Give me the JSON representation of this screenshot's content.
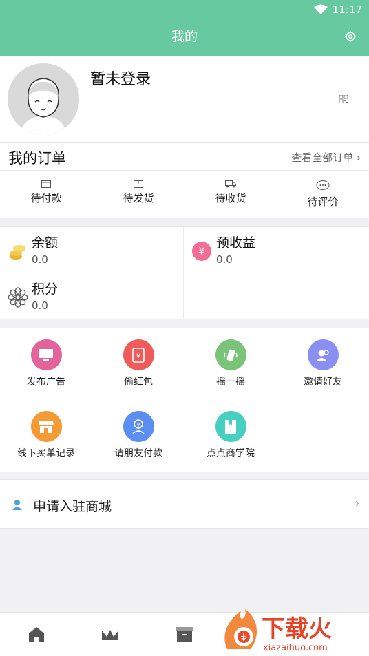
{
  "status": {
    "time": "11:17"
  },
  "header": {
    "title": "我的"
  },
  "profile": {
    "name": "暂未登录"
  },
  "orders": {
    "title": "我的订单",
    "view_all": "查看全部订单 ›",
    "items": [
      {
        "label": "待付款",
        "icon": "wallet-icon"
      },
      {
        "label": "待发货",
        "icon": "package-icon"
      },
      {
        "label": "待收货",
        "icon": "truck-icon"
      },
      {
        "label": "待评价",
        "icon": "comment-icon"
      }
    ]
  },
  "wallet": {
    "balance": {
      "label": "余额",
      "value": "0.0"
    },
    "expected": {
      "label": "预收益",
      "value": "0.0"
    },
    "points": {
      "label": "积分",
      "value": "0.0"
    }
  },
  "features": [
    {
      "label": "发布广告",
      "color": "#e2649b",
      "icon": "monitor-icon"
    },
    {
      "label": "偷红包",
      "color": "#ef5b5b",
      "icon": "red-envelope-icon"
    },
    {
      "label": "摇一摇",
      "color": "#79c479",
      "icon": "shake-icon"
    },
    {
      "label": "邀请好友",
      "color": "#8a8ff3",
      "icon": "invite-friends-icon"
    },
    {
      "label": "线下买单记录",
      "color": "#f59a34",
      "icon": "shop-icon"
    },
    {
      "label": "请朋友付款",
      "color": "#5a8ef0",
      "icon": "pay-friend-icon"
    },
    {
      "label": "点点商学院",
      "color": "#47cfc0",
      "icon": "book-icon"
    }
  ],
  "join": {
    "label": "申请入驻商城",
    "chevron": "›"
  },
  "tabs": [
    {
      "icon": "home-icon"
    },
    {
      "icon": "crown-icon"
    },
    {
      "icon": "box-icon"
    }
  ],
  "watermark": {
    "brand": "下载火",
    "url": "xiazaihuo.com"
  }
}
